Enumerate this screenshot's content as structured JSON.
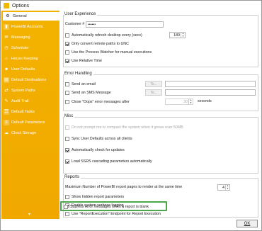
{
  "window": {
    "title": "Options"
  },
  "sidebar": {
    "items": [
      {
        "label": "General",
        "icon": "gear-icon",
        "active": true
      },
      {
        "label": "PowerBI Accounts",
        "icon": "powerbi-icon",
        "active": false
      },
      {
        "label": "Messaging",
        "icon": "envelope-icon",
        "active": false
      },
      {
        "label": "Scheduler",
        "icon": "clock-icon",
        "active": false
      },
      {
        "label": "House Keeping",
        "icon": "house-icon",
        "active": false
      },
      {
        "label": "User Defaults",
        "icon": "user-icon",
        "active": false
      },
      {
        "label": "Default Destinations",
        "icon": "folder-icon",
        "active": false
      },
      {
        "label": "System Paths",
        "icon": "path-icon",
        "active": false
      },
      {
        "label": "Audit Trail",
        "icon": "audit-icon",
        "active": false
      },
      {
        "label": "Default Tasks",
        "icon": "tasks-icon",
        "active": false
      },
      {
        "label": "Default Parameters",
        "icon": "parameters-icon",
        "active": false
      },
      {
        "label": "Cloud Storage",
        "icon": "cloud-icon",
        "active": false
      }
    ]
  },
  "user_experience": {
    "title": "User Experience",
    "customer_label": "Customer #",
    "customer_value": "••••••",
    "auto_refresh": {
      "label": "Automatically refresh desktop every (secs)",
      "checked": false,
      "value": "180"
    },
    "convert_unc": {
      "label": "Only convert remote paths to UNC",
      "checked": true
    },
    "process_watcher": {
      "label": "Use the Process Watcher for manual executions",
      "checked": false
    },
    "relative_time": {
      "label": "Use Relative Time",
      "checked": true
    }
  },
  "error_handling": {
    "title": "Error Handling",
    "send_email": {
      "label": "Send an email",
      "checked": false,
      "to_label": "To..."
    },
    "send_sms": {
      "label": "Send an SMS Message",
      "checked": false,
      "to_label": "To..."
    },
    "close_oops": {
      "label": "Close \"Oops\" error messages after",
      "checked": false,
      "value": "30",
      "unit": "seconds"
    }
  },
  "misc": {
    "title": "Misc",
    "compact": {
      "label": "Do not prompt me to compact the system when it grows over 50MB",
      "checked": false
    },
    "sync_user_defaults": {
      "label": "Sync User Defaults across all clients",
      "checked": false
    },
    "check_updates": {
      "label": "Automatically check for updates",
      "checked": true
    },
    "load_ssrs": {
      "label": "Load SSRS cascading parameters automatically",
      "checked": true
    }
  },
  "reports": {
    "title": "Reports",
    "max_pages": {
      "label": "Maximum Number of PowerBI report pages to render at the same time",
      "value": "4"
    },
    "show_hidden": {
      "label": "Show hidden report parameters",
      "checked": false
    },
    "verbose": {
      "label": "Enable system verbose logging",
      "checked": true
    },
    "report_execution": {
      "label": "Use \"ReportExecution\" Endpoint for Report Execution",
      "checked": false
    },
    "supress_errors": {
      "label": "Supress error messages when a report is blank",
      "checked": false
    }
  },
  "footer": {
    "ok_label": "OK"
  },
  "colors": {
    "sidebar": "#f0a800",
    "highlight": "#4ca64c"
  }
}
